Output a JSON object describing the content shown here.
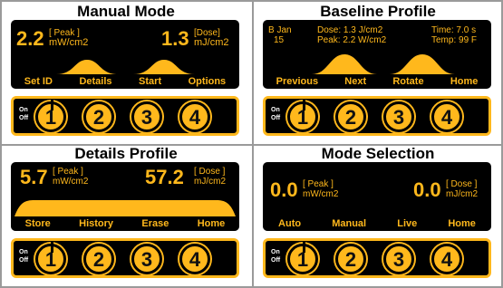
{
  "colors": {
    "accent": "#ffb81c",
    "screen": "#000000",
    "text": "#000000"
  },
  "manual": {
    "title": "Manual Mode",
    "peak_value": "2.2",
    "peak_tag": "[ Peak ]",
    "peak_unit": "mW/cm2",
    "dose_value": "1.3",
    "dose_tag": "[Dose]",
    "dose_unit": "mJ/cm2",
    "softkeys": [
      "Set ID",
      "Details",
      "Start",
      "Options"
    ]
  },
  "baseline": {
    "title": "Baseline Profile",
    "date_line1": "B Jan",
    "date_line2": "15",
    "dose": "Dose:  1.3  J/cm2",
    "time": "Time: 7.0 s",
    "peak": "Peak: 2.2 W/cm2",
    "temp": "Temp: 99 F",
    "softkeys": [
      "Previous",
      "Next",
      "Rotate",
      "Home"
    ]
  },
  "details": {
    "title": "Details Profile",
    "peak_value": "5.7",
    "peak_tag": "[ Peak ]",
    "peak_unit": "mW/cm2",
    "dose_value": "57.2",
    "dose_tag": "[ Dose ]",
    "dose_unit": "mJ/cm2",
    "softkeys": [
      "Store",
      "History",
      "Erase",
      "Home"
    ]
  },
  "mode": {
    "title": "Mode Selection",
    "peak_value": "0.0",
    "peak_tag": "[ Peak ]",
    "peak_unit": "mW/cm2",
    "dose_value": "0.0",
    "dose_tag": "[ Dose ]",
    "dose_unit": "mJ/cm2",
    "softkeys": [
      "Auto",
      "Manual",
      "Live",
      "Home"
    ]
  },
  "keypad": {
    "on_label": "On",
    "off_label": "Off",
    "buttons": [
      "1",
      "2",
      "3",
      "4"
    ]
  }
}
